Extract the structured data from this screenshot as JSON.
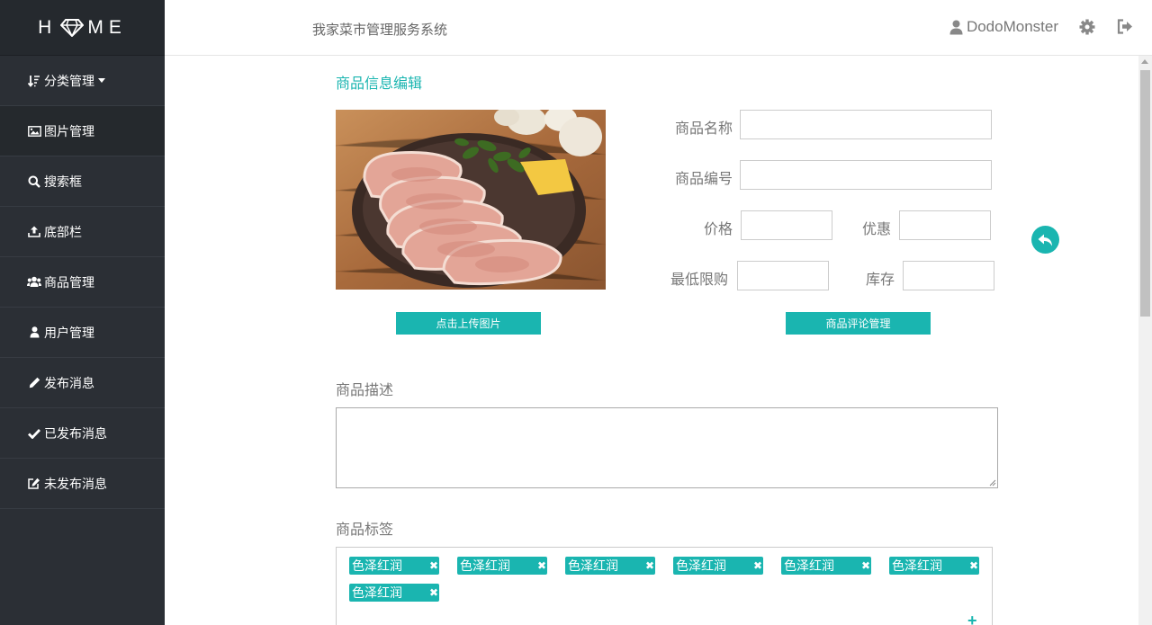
{
  "logo": {
    "left": "H",
    "right": "ME"
  },
  "sidebar": {
    "items": [
      {
        "label": "分类管理",
        "icon": "sort-icon"
      },
      {
        "label": "图片管理",
        "icon": "image-icon"
      },
      {
        "label": "搜索框",
        "icon": "search-icon"
      },
      {
        "label": "底部栏",
        "icon": "upload-icon"
      },
      {
        "label": "商品管理",
        "icon": "users-icon"
      },
      {
        "label": "用户管理",
        "icon": "user-icon"
      },
      {
        "label": "发布消息",
        "icon": "pencil-icon"
      },
      {
        "label": "已发布消息",
        "icon": "check-icon"
      },
      {
        "label": "未发布消息",
        "icon": "edit-icon"
      }
    ]
  },
  "header": {
    "title": "我家菜市管理服务系统",
    "username": "DodoMonster"
  },
  "main": {
    "edit_title": "商品信息编辑",
    "upload_button": "点击上传图片",
    "review_button": "商品评论管理",
    "fields": {
      "name_label": "商品名称",
      "code_label": "商品编号",
      "price_label": "价格",
      "discount_label": "优惠",
      "min_label": "最低限购",
      "stock_label": "库存"
    },
    "desc_label": "商品描述",
    "tags_label": "商品标签",
    "tags": [
      "色泽红润",
      "色泽红润",
      "色泽红润",
      "色泽红润",
      "色泽红润",
      "色泽红润",
      "色泽红润"
    ],
    "tag_remove": "✖",
    "tag_add": "+"
  },
  "colors": {
    "accent": "#1ab5b0",
    "sidebar": "#2b2f35"
  }
}
